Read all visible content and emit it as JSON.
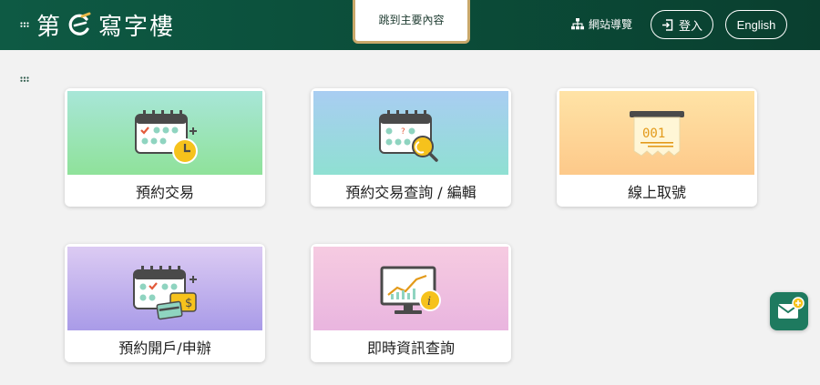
{
  "header": {
    "logo_left": "第",
    "logo_right": "寫字樓",
    "skip_link": "跳到主要內容",
    "sitemap": "網站導覽",
    "login": "登入",
    "language": "English"
  },
  "colors": {
    "header_bg": "#0b4d39",
    "accent_gold": "#c9a86a",
    "fab": "#1e7a5f"
  },
  "cards": [
    {
      "label": "預約交易",
      "icon": "calendar-clock-icon"
    },
    {
      "label": "預約交易查詢 / 編輯",
      "icon": "calendar-search-icon"
    },
    {
      "label": "線上取號",
      "icon": "queue-ticket-icon"
    },
    {
      "label": "預約開戶/申辦",
      "icon": "calendar-card-icon"
    },
    {
      "label": "即時資訊查詢",
      "icon": "monitor-chart-icon"
    }
  ],
  "ticket_number": "001",
  "fab_icon": "mail-icon"
}
